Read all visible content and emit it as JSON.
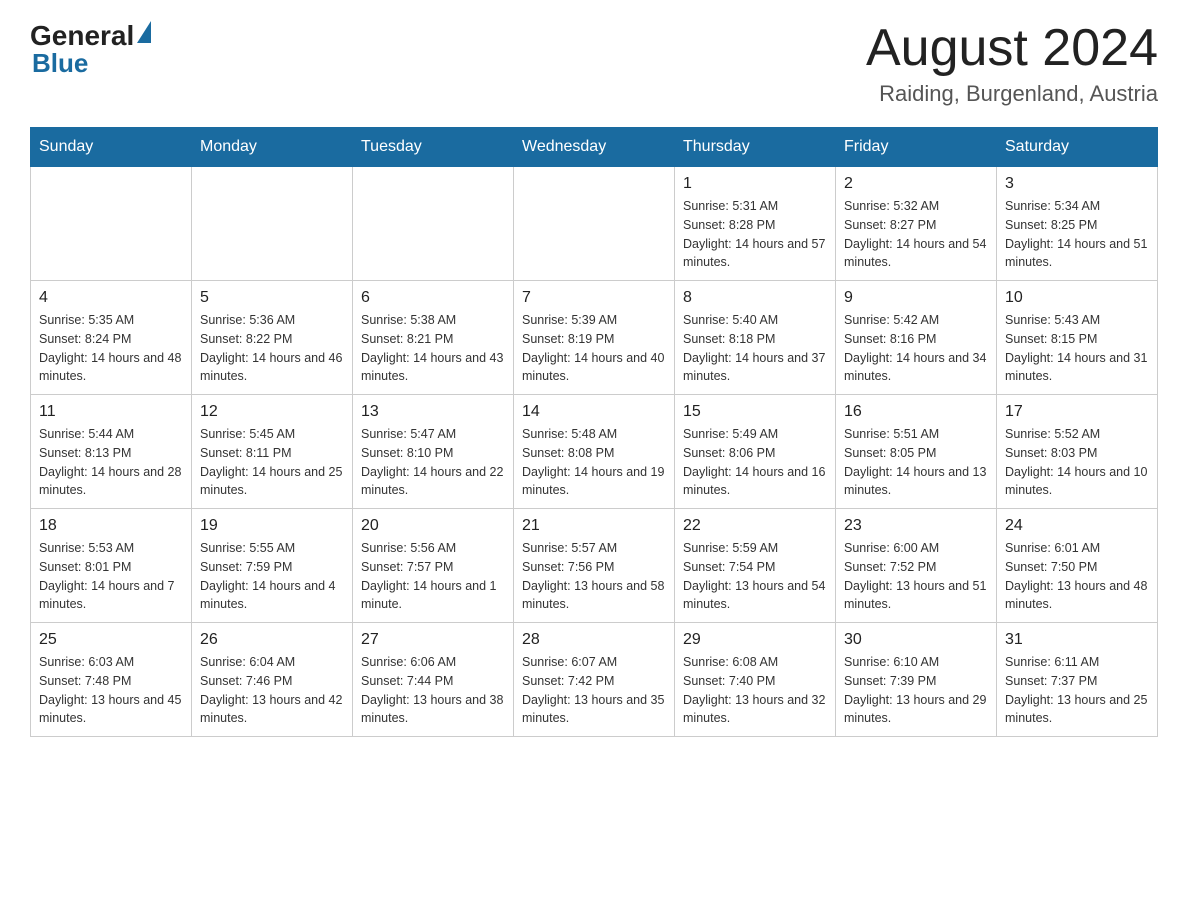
{
  "header": {
    "logo_general": "General",
    "logo_blue": "Blue",
    "month_title": "August 2024",
    "location": "Raiding, Burgenland, Austria"
  },
  "days_of_week": [
    "Sunday",
    "Monday",
    "Tuesday",
    "Wednesday",
    "Thursday",
    "Friday",
    "Saturday"
  ],
  "weeks": [
    {
      "days": [
        {
          "number": "",
          "sunrise": "",
          "sunset": "",
          "daylight": ""
        },
        {
          "number": "",
          "sunrise": "",
          "sunset": "",
          "daylight": ""
        },
        {
          "number": "",
          "sunrise": "",
          "sunset": "",
          "daylight": ""
        },
        {
          "number": "",
          "sunrise": "",
          "sunset": "",
          "daylight": ""
        },
        {
          "number": "1",
          "sunrise": "Sunrise: 5:31 AM",
          "sunset": "Sunset: 8:28 PM",
          "daylight": "Daylight: 14 hours and 57 minutes."
        },
        {
          "number": "2",
          "sunrise": "Sunrise: 5:32 AM",
          "sunset": "Sunset: 8:27 PM",
          "daylight": "Daylight: 14 hours and 54 minutes."
        },
        {
          "number": "3",
          "sunrise": "Sunrise: 5:34 AM",
          "sunset": "Sunset: 8:25 PM",
          "daylight": "Daylight: 14 hours and 51 minutes."
        }
      ]
    },
    {
      "days": [
        {
          "number": "4",
          "sunrise": "Sunrise: 5:35 AM",
          "sunset": "Sunset: 8:24 PM",
          "daylight": "Daylight: 14 hours and 48 minutes."
        },
        {
          "number": "5",
          "sunrise": "Sunrise: 5:36 AM",
          "sunset": "Sunset: 8:22 PM",
          "daylight": "Daylight: 14 hours and 46 minutes."
        },
        {
          "number": "6",
          "sunrise": "Sunrise: 5:38 AM",
          "sunset": "Sunset: 8:21 PM",
          "daylight": "Daylight: 14 hours and 43 minutes."
        },
        {
          "number": "7",
          "sunrise": "Sunrise: 5:39 AM",
          "sunset": "Sunset: 8:19 PM",
          "daylight": "Daylight: 14 hours and 40 minutes."
        },
        {
          "number": "8",
          "sunrise": "Sunrise: 5:40 AM",
          "sunset": "Sunset: 8:18 PM",
          "daylight": "Daylight: 14 hours and 37 minutes."
        },
        {
          "number": "9",
          "sunrise": "Sunrise: 5:42 AM",
          "sunset": "Sunset: 8:16 PM",
          "daylight": "Daylight: 14 hours and 34 minutes."
        },
        {
          "number": "10",
          "sunrise": "Sunrise: 5:43 AM",
          "sunset": "Sunset: 8:15 PM",
          "daylight": "Daylight: 14 hours and 31 minutes."
        }
      ]
    },
    {
      "days": [
        {
          "number": "11",
          "sunrise": "Sunrise: 5:44 AM",
          "sunset": "Sunset: 8:13 PM",
          "daylight": "Daylight: 14 hours and 28 minutes."
        },
        {
          "number": "12",
          "sunrise": "Sunrise: 5:45 AM",
          "sunset": "Sunset: 8:11 PM",
          "daylight": "Daylight: 14 hours and 25 minutes."
        },
        {
          "number": "13",
          "sunrise": "Sunrise: 5:47 AM",
          "sunset": "Sunset: 8:10 PM",
          "daylight": "Daylight: 14 hours and 22 minutes."
        },
        {
          "number": "14",
          "sunrise": "Sunrise: 5:48 AM",
          "sunset": "Sunset: 8:08 PM",
          "daylight": "Daylight: 14 hours and 19 minutes."
        },
        {
          "number": "15",
          "sunrise": "Sunrise: 5:49 AM",
          "sunset": "Sunset: 8:06 PM",
          "daylight": "Daylight: 14 hours and 16 minutes."
        },
        {
          "number": "16",
          "sunrise": "Sunrise: 5:51 AM",
          "sunset": "Sunset: 8:05 PM",
          "daylight": "Daylight: 14 hours and 13 minutes."
        },
        {
          "number": "17",
          "sunrise": "Sunrise: 5:52 AM",
          "sunset": "Sunset: 8:03 PM",
          "daylight": "Daylight: 14 hours and 10 minutes."
        }
      ]
    },
    {
      "days": [
        {
          "number": "18",
          "sunrise": "Sunrise: 5:53 AM",
          "sunset": "Sunset: 8:01 PM",
          "daylight": "Daylight: 14 hours and 7 minutes."
        },
        {
          "number": "19",
          "sunrise": "Sunrise: 5:55 AM",
          "sunset": "Sunset: 7:59 PM",
          "daylight": "Daylight: 14 hours and 4 minutes."
        },
        {
          "number": "20",
          "sunrise": "Sunrise: 5:56 AM",
          "sunset": "Sunset: 7:57 PM",
          "daylight": "Daylight: 14 hours and 1 minute."
        },
        {
          "number": "21",
          "sunrise": "Sunrise: 5:57 AM",
          "sunset": "Sunset: 7:56 PM",
          "daylight": "Daylight: 13 hours and 58 minutes."
        },
        {
          "number": "22",
          "sunrise": "Sunrise: 5:59 AM",
          "sunset": "Sunset: 7:54 PM",
          "daylight": "Daylight: 13 hours and 54 minutes."
        },
        {
          "number": "23",
          "sunrise": "Sunrise: 6:00 AM",
          "sunset": "Sunset: 7:52 PM",
          "daylight": "Daylight: 13 hours and 51 minutes."
        },
        {
          "number": "24",
          "sunrise": "Sunrise: 6:01 AM",
          "sunset": "Sunset: 7:50 PM",
          "daylight": "Daylight: 13 hours and 48 minutes."
        }
      ]
    },
    {
      "days": [
        {
          "number": "25",
          "sunrise": "Sunrise: 6:03 AM",
          "sunset": "Sunset: 7:48 PM",
          "daylight": "Daylight: 13 hours and 45 minutes."
        },
        {
          "number": "26",
          "sunrise": "Sunrise: 6:04 AM",
          "sunset": "Sunset: 7:46 PM",
          "daylight": "Daylight: 13 hours and 42 minutes."
        },
        {
          "number": "27",
          "sunrise": "Sunrise: 6:06 AM",
          "sunset": "Sunset: 7:44 PM",
          "daylight": "Daylight: 13 hours and 38 minutes."
        },
        {
          "number": "28",
          "sunrise": "Sunrise: 6:07 AM",
          "sunset": "Sunset: 7:42 PM",
          "daylight": "Daylight: 13 hours and 35 minutes."
        },
        {
          "number": "29",
          "sunrise": "Sunrise: 6:08 AM",
          "sunset": "Sunset: 7:40 PM",
          "daylight": "Daylight: 13 hours and 32 minutes."
        },
        {
          "number": "30",
          "sunrise": "Sunrise: 6:10 AM",
          "sunset": "Sunset: 7:39 PM",
          "daylight": "Daylight: 13 hours and 29 minutes."
        },
        {
          "number": "31",
          "sunrise": "Sunrise: 6:11 AM",
          "sunset": "Sunset: 7:37 PM",
          "daylight": "Daylight: 13 hours and 25 minutes."
        }
      ]
    }
  ]
}
